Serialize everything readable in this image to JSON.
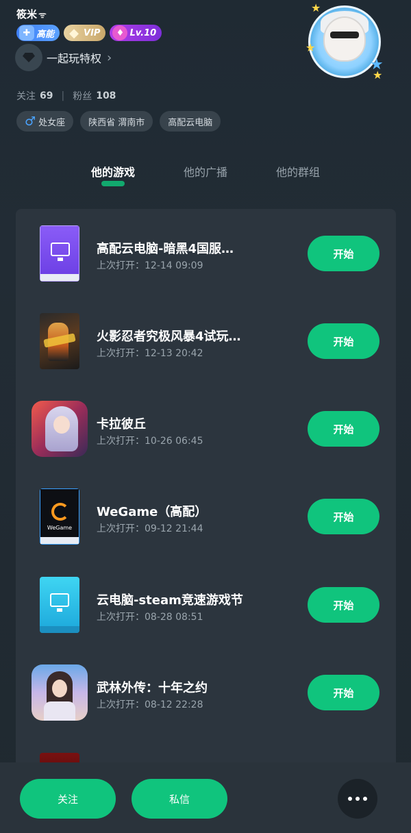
{
  "profile": {
    "username": "筱米",
    "badges": {
      "gaoneng": "高能",
      "vip": "VIP",
      "level": "Lv.10"
    },
    "privilege_label": "一起玩特权",
    "stats": {
      "following_label": "关注",
      "following_count": "69",
      "fans_label": "粉丝",
      "fans_count": "108"
    },
    "tags": [
      "处女座",
      "陕西省 渭南市",
      "高配云电脑"
    ]
  },
  "tabs": [
    {
      "label": "他的游戏",
      "active": true
    },
    {
      "label": "他的广播",
      "active": false
    },
    {
      "label": "他的群组",
      "active": false
    }
  ],
  "games": [
    {
      "title": "高配云电脑-暗黑4国服…",
      "last_open": "上次打开：12-14 09:09",
      "button": "开始",
      "thumb": "cloud-pc-purple"
    },
    {
      "title": "火影忍者究极风暴4试玩…",
      "last_open": "上次打开：12-13 20:42",
      "button": "开始",
      "thumb": "naruto-poster"
    },
    {
      "title": "卡拉彼丘",
      "last_open": "上次打开：10-26 06:45",
      "button": "开始",
      "thumb": "kala-icon"
    },
    {
      "title": "WeGame（高配）",
      "last_open": "上次打开：09-12 21:44",
      "button": "开始",
      "thumb": "wegame-poster"
    },
    {
      "title": "云电脑-steam竞速游戏节",
      "last_open": "上次打开：08-28 08:51",
      "button": "开始",
      "thumb": "cloud-pc-cyan"
    },
    {
      "title": "武林外传：十年之约",
      "last_open": "上次打开：08-12 22:28",
      "button": "开始",
      "thumb": "wulin-icon"
    }
  ],
  "bottom_bar": {
    "follow_label": "关注",
    "message_label": "私信",
    "more_icon": "more-dots-icon"
  },
  "colors": {
    "accent": "#10c47d",
    "background": "#222c35",
    "card": "#2c353e"
  }
}
